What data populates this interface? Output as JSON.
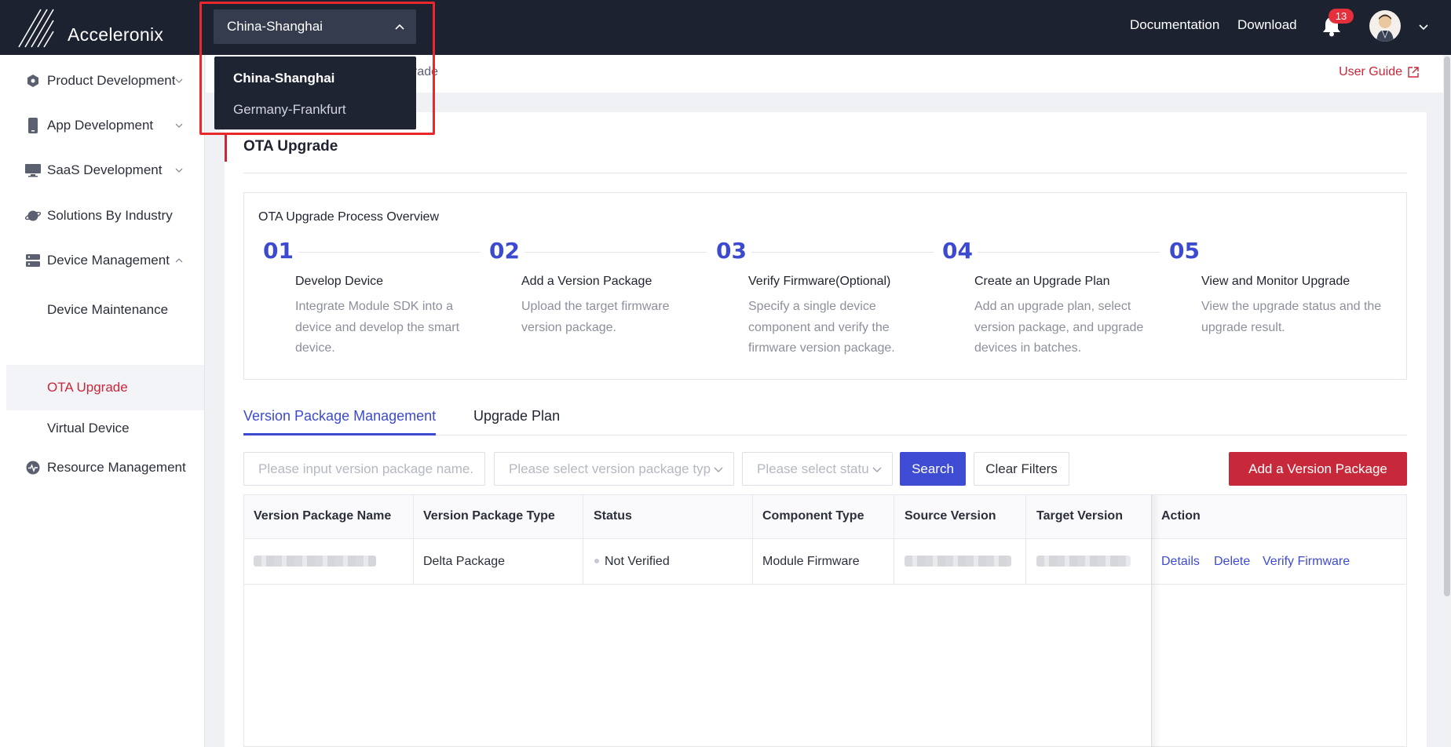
{
  "header": {
    "brand": "Acceleronix",
    "region_selected": "China-Shanghai",
    "links": {
      "documentation": "Documentation",
      "download": "Download"
    },
    "notifications_count": "13"
  },
  "region_dropdown": {
    "options": [
      "China-Shanghai",
      "Germany-Frankfurt"
    ]
  },
  "sidebar": {
    "items": [
      {
        "label": "Product Development"
      },
      {
        "label": "App Development"
      },
      {
        "label": "SaaS Development"
      },
      {
        "label": "Solutions By Industry"
      },
      {
        "label": "Device Management"
      },
      {
        "label": "Resource Management"
      }
    ],
    "sub_items": [
      {
        "label": "Device Maintenance"
      },
      {
        "label": "OTA Upgrade"
      },
      {
        "label": "Virtual Device"
      }
    ]
  },
  "breadcrumb": {
    "partial": "rade"
  },
  "user_guide": "User Guide",
  "page_title": "OTA Upgrade",
  "process": {
    "title": "OTA Upgrade Process Overview",
    "steps": [
      {
        "num": "01",
        "title": "Develop Device",
        "desc": "Integrate Module SDK into a device and develop the smart device."
      },
      {
        "num": "02",
        "title": "Add a Version Package",
        "desc": "Upload the target firmware version package."
      },
      {
        "num": "03",
        "title": "Verify Firmware(Optional)",
        "desc": "Specify a single device component and verify the firmware version package."
      },
      {
        "num": "04",
        "title": "Create an Upgrade Plan",
        "desc": "Add an upgrade plan, select version package, and upgrade devices in batches."
      },
      {
        "num": "05",
        "title": "View and Monitor Upgrade",
        "desc": "View the upgrade status and the upgrade result."
      }
    ]
  },
  "tabs": [
    "Version Package Management",
    "Upgrade Plan"
  ],
  "filters": {
    "name_placeholder": "Please input version package name.",
    "type_placeholder": "Please select version package typ",
    "status_placeholder": "Please select statu",
    "search": "Search",
    "clear": "Clear Filters",
    "add": "Add a Version Package"
  },
  "table": {
    "columns": [
      "Version Package Name",
      "Version Package Type",
      "Status",
      "Component Type",
      "Source Version",
      "Target Version",
      "Action"
    ],
    "rows": [
      {
        "type": "Delta Package",
        "status": "Not Verified",
        "component": "Module Firmware",
        "actions": [
          "Details",
          "Delete",
          "Verify Firmware"
        ]
      }
    ]
  },
  "colors": {
    "accent_red": "#c7283a",
    "primary_blue": "#3e4bd3",
    "topbar": "#1c2230",
    "highlight": "#e8282b"
  }
}
